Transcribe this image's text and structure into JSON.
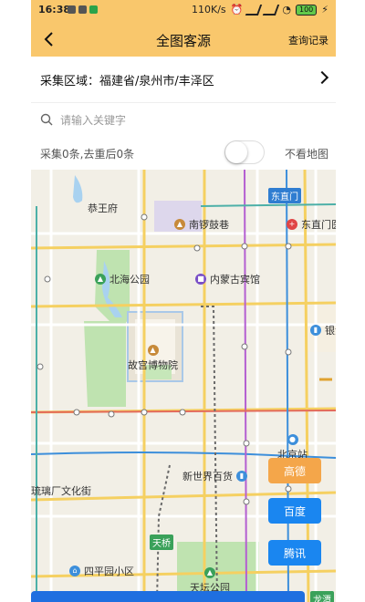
{
  "status_bar": {
    "time": "16:38",
    "speed": "110K/s",
    "battery": "100"
  },
  "header": {
    "title": "全图客源",
    "query_label": "查询记录"
  },
  "region": {
    "label": "采集区域：福建省/泉州市/丰泽区"
  },
  "search": {
    "placeholder": "请输入关键字"
  },
  "info": {
    "count_text": "采集0条,去重后0条",
    "toggle_on": false,
    "no_map_label": "不看地图"
  },
  "map": {
    "places": {
      "gongwangfu": "恭王府",
      "nanluoguxiang": "南锣鼓巷",
      "dongzhimen_station": "东直门",
      "dongzhimen_hosp": "东直门医",
      "beihai": "北海公园",
      "neimenggu": "内蒙古宾馆",
      "yinhe": "银河",
      "gugong": "故宫博物院",
      "beijingzhan": "北京站",
      "xinshijie": "新世界百货",
      "liulichang": "琉璃厂文化街",
      "tianqiao": "天桥",
      "siping": "四平园小区",
      "tiantan": "天坛公园",
      "longtan": "龙潭"
    }
  },
  "buttons": {
    "gaode": "高德",
    "baidu": "百度",
    "tencent": "腾讯"
  },
  "colors": {
    "header_bg": "#f9c76c",
    "gaode": "#f4a64a",
    "baidu": "#1a86f0",
    "tencent": "#1a86f0"
  }
}
